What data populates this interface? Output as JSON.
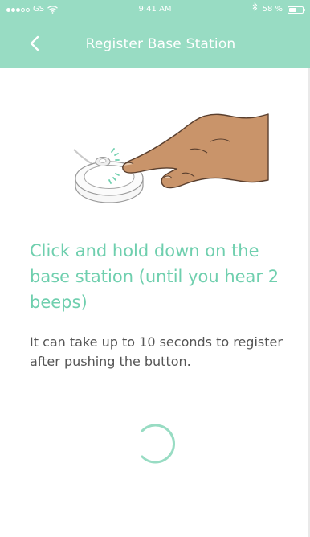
{
  "status_bar": {
    "carrier": "GS",
    "time": "9:41 AM",
    "battery_percent": "58 %",
    "battery_level": 0.58,
    "signal_bars_filled": 3,
    "signal_bars_total": 5,
    "icons": [
      "signal-icon",
      "wifi-icon",
      "bluetooth-icon",
      "battery-icon"
    ]
  },
  "nav": {
    "title": "Register Base Station",
    "back_icon": "chevron-left-icon"
  },
  "colors": {
    "header_bg": "#98dcc3",
    "accent": "#6fcfae",
    "body_text": "#555555",
    "skin": "#c9946a"
  },
  "illustration": {
    "name": "hand-pressing-base-station"
  },
  "main": {
    "heading": "Click and hold down on the base station (until you hear 2 beeps)",
    "description": "It can take up to 10 seconds to register after pushing the button."
  },
  "loading": {
    "icon": "loading-spinner"
  }
}
